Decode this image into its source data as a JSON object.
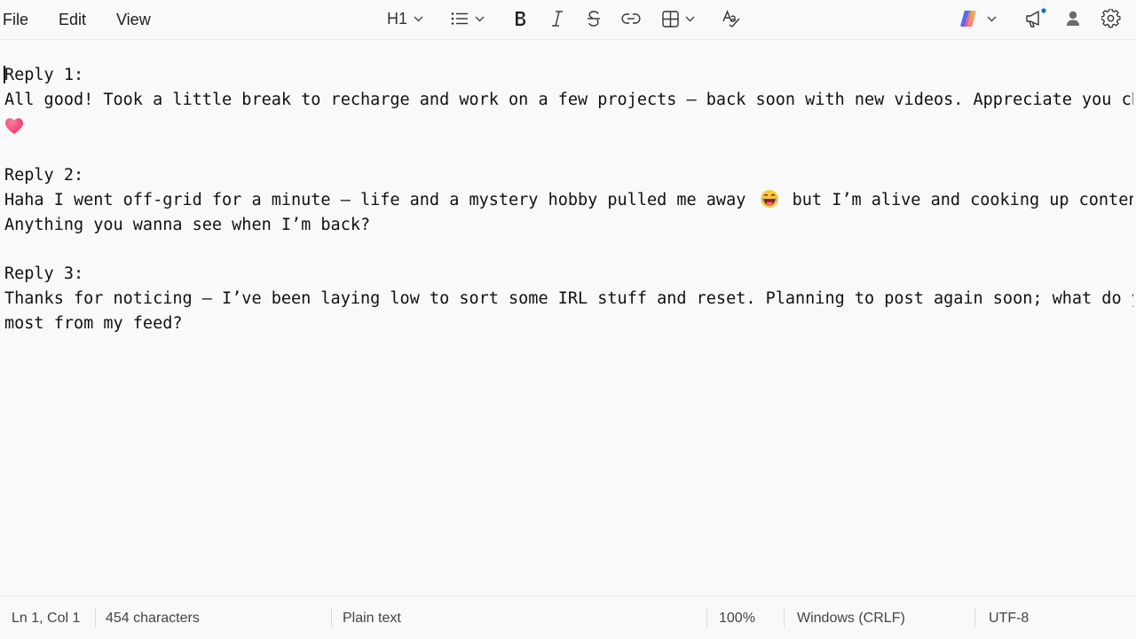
{
  "menu": {
    "file": "File",
    "edit": "Edit",
    "view": "View"
  },
  "toolbar": {
    "heading_label": "H1",
    "icons": [
      "list-icon",
      "bold-icon",
      "italic-icon",
      "strikethrough-icon",
      "link-icon",
      "table-icon",
      "spellcheck-icon",
      "copilot-icon",
      "megaphone-icon",
      "account-icon",
      "gear-icon"
    ]
  },
  "document": {
    "reply1_label": "Reply 1:",
    "reply1_line1": "All good! Took a little break to recharge and work on a few projects — back soon with new videos. Appreciate you checking in",
    "reply2_label": "Reply 2:",
    "reply2_line1_a": "Haha I went off-grid for a minute — life and a mystery hobby pulled me away",
    "reply2_line1_b": "but I’m alive and cooking up content.",
    "reply2_line2": "Anything you wanna see when I’m back?",
    "reply3_label": "Reply 3:",
    "reply3_line1": "Thanks for noticing — I’ve been laying low to sort some IRL stuff and reset. Planning to post again soon; what do you miss",
    "reply3_line2": "most from my feed?"
  },
  "status": {
    "position": "Ln 1, Col 1",
    "characters": "454 characters",
    "format": "Plain text",
    "zoom": "100%",
    "line_ending": "Windows (CRLF)",
    "encoding": "UTF-8"
  },
  "colors": {
    "background": "#f9f9f9",
    "heart": "#e8336b",
    "notification_dot": "#0f6cbd"
  }
}
